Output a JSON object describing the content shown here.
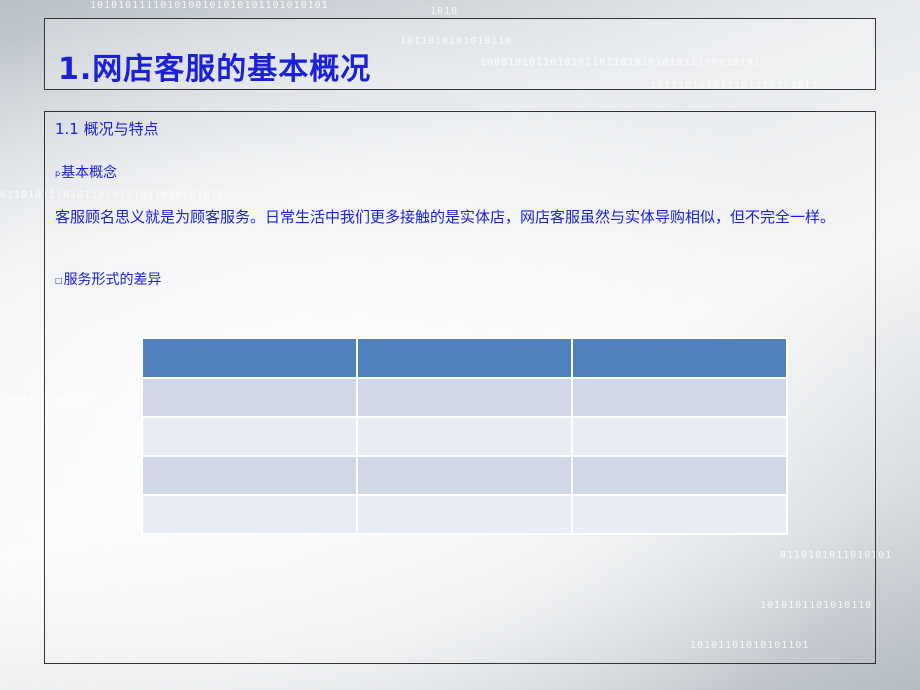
{
  "slide": {
    "title": "1.网店客服的基本概况",
    "subtitle": "1.1 概况与特点",
    "bullet1": {
      "marker": "p",
      "text": "基本概念"
    },
    "paragraph": "客服顾名思义就是为顾客服务。日常生活中我们更多接触的是实体店，网店客服虽然与实体导购相似，但不完全一样。",
    "bullet2": {
      "marker": "□",
      "text": "服务形式的差异"
    }
  },
  "table": {
    "headers": [
      "",
      "",
      ""
    ],
    "rows": [
      [
        "",
        "",
        ""
      ],
      [
        "",
        "",
        ""
      ],
      [
        "",
        "",
        ""
      ],
      [
        "",
        "",
        ""
      ]
    ]
  },
  "colors": {
    "title": "#1a21d6",
    "header": "#4f81bd",
    "row_odd": "#d0d8e8",
    "row_even": "#e9edf4"
  }
}
